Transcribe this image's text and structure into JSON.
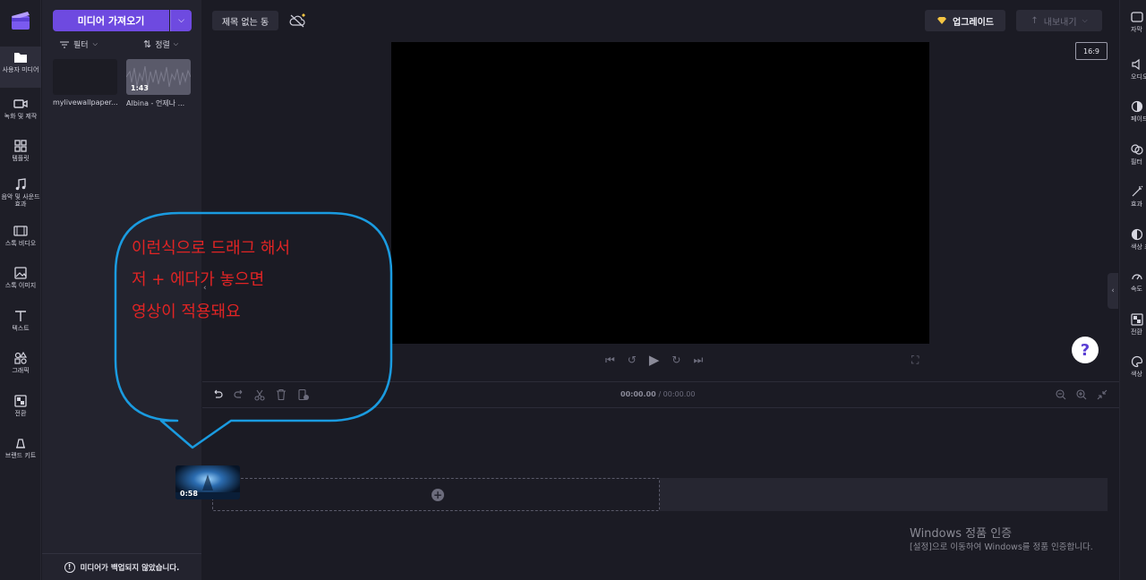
{
  "leftnav": {
    "items": [
      {
        "label": "사용자 미디어",
        "icon": "folder-icon"
      },
      {
        "label": "녹화 및 제작",
        "icon": "camera-icon"
      },
      {
        "label": "템플릿",
        "icon": "templates-icon"
      },
      {
        "label": "음악 및 사운드 효과",
        "icon": "music-icon"
      },
      {
        "label": "스톡 비디오",
        "icon": "film-icon"
      },
      {
        "label": "스톡 이미지",
        "icon": "image-icon"
      },
      {
        "label": "텍스트",
        "icon": "text-icon"
      },
      {
        "label": "그래픽",
        "icon": "graphics-icon"
      },
      {
        "label": "전환",
        "icon": "transition-icon"
      },
      {
        "label": "브랜드 키트",
        "icon": "brand-kit-icon"
      }
    ]
  },
  "media": {
    "import_label": "미디어 가져오기",
    "filter_label": "필터",
    "sort_label": "정렬",
    "items": [
      {
        "name": "mylivewallpaper...",
        "duration": ""
      },
      {
        "name": "Albina - 언제나 ...",
        "duration": "1:43"
      }
    ],
    "backup_notice": "미디어가 백업되지 않았습니다."
  },
  "topbar": {
    "project_title": "제목 없는 동",
    "upgrade_label": "업그레이드",
    "export_label": "내보내기",
    "aspect_ratio": "16:9"
  },
  "help": {
    "label": "?"
  },
  "rightpanel": {
    "items": [
      {
        "label": "자막",
        "icon": "captions-icon"
      },
      {
        "label": "오디오",
        "icon": "speaker-icon"
      },
      {
        "label": "페이드",
        "icon": "fade-icon"
      },
      {
        "label": "필터",
        "icon": "filters-icon"
      },
      {
        "label": "효과",
        "icon": "effects-icon"
      },
      {
        "label": "색상 조정",
        "icon": "color-adjust-icon"
      },
      {
        "label": "속도",
        "icon": "speed-icon"
      },
      {
        "label": "전환",
        "icon": "transition-icon"
      },
      {
        "label": "색상",
        "icon": "palette-icon"
      }
    ]
  },
  "timeline": {
    "current_time": "00:00.00",
    "total_time": "/ 00:00.00",
    "dragged_clip_duration": "0:58"
  },
  "annotation": {
    "lines": [
      "이런식으로 드래그 해서",
      "저 + 에다가 놓으면",
      "영상이 적용돼요"
    ],
    "color": "#e02424",
    "border_color": "#1a9be0"
  },
  "watermark": {
    "title": "Windows 정품 인증",
    "subtitle": "[설정]으로 이동하여 Windows를 정품 인증합니다."
  },
  "colors": {
    "accent": "#6e4ae0",
    "background": "#1b1b24"
  }
}
